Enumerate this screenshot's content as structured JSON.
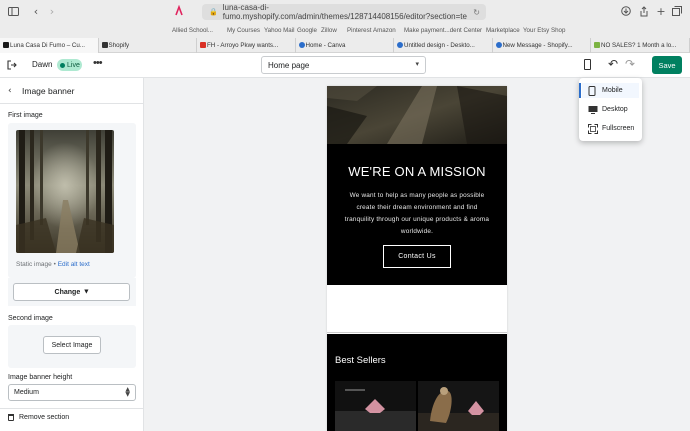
{
  "browser": {
    "url": "luna-casa-di-fumo.myshopify.com/admin/themes/128714408156/editor?section=te",
    "bookmarks": [
      "Allied School...",
      "My Courses",
      "Yahoo Mail",
      "Google",
      "Zillow",
      "Pinterest",
      "Amazon",
      "Make payment...dent Center",
      "Marketplace",
      "Your Etsy Shop"
    ],
    "tabs": [
      {
        "label": "Luna Casa Di Fumo – Cu...",
        "active": true,
        "color": "#1a1a1a"
      },
      {
        "label": "Shopify",
        "active": false,
        "color": "#95bf47"
      },
      {
        "label": "FH - Arroyo Pkwy wants...",
        "active": false,
        "color": "#d93025"
      },
      {
        "label": "Home - Canva",
        "active": false,
        "color": "#00c4cc"
      },
      {
        "label": "Untitled design - Deskto...",
        "active": false,
        "color": "#7d2ae8"
      },
      {
        "label": "New Message - Shopify...",
        "active": false,
        "color": "#2c6ecb"
      },
      {
        "label": "NO SALES? 1 Month a lo...",
        "active": false,
        "color": "#7cb342"
      }
    ]
  },
  "topbar": {
    "theme_name": "Dawn",
    "live_label": "Live",
    "page_select": "Home page",
    "save_label": "Save"
  },
  "sidebar": {
    "title": "Image banner",
    "first_image_label": "First image",
    "static_image_text": "Static image",
    "edit_alt_text": "Edit alt text",
    "change_label": "Change",
    "second_image_label": "Second image",
    "select_image_label": "Select Image",
    "banner_height_label": "Image banner height",
    "banner_height_value": "Medium",
    "remove_section_label": "Remove section"
  },
  "preview": {
    "mission_heading": "WE'RE ON A MISSION",
    "mission_text": "We want to help as many people as possible create their dream environment and find tranquility through our unique products & aroma worldwide.",
    "contact_button": "Contact Us",
    "best_sellers_heading": "Best Sellers"
  },
  "device_menu": {
    "items": [
      "Mobile",
      "Desktop",
      "Fullscreen"
    ],
    "selected": "Mobile"
  },
  "colors": {
    "accent": "#008060",
    "link": "#2c6ecb",
    "live_badge": "#aee9d1"
  }
}
